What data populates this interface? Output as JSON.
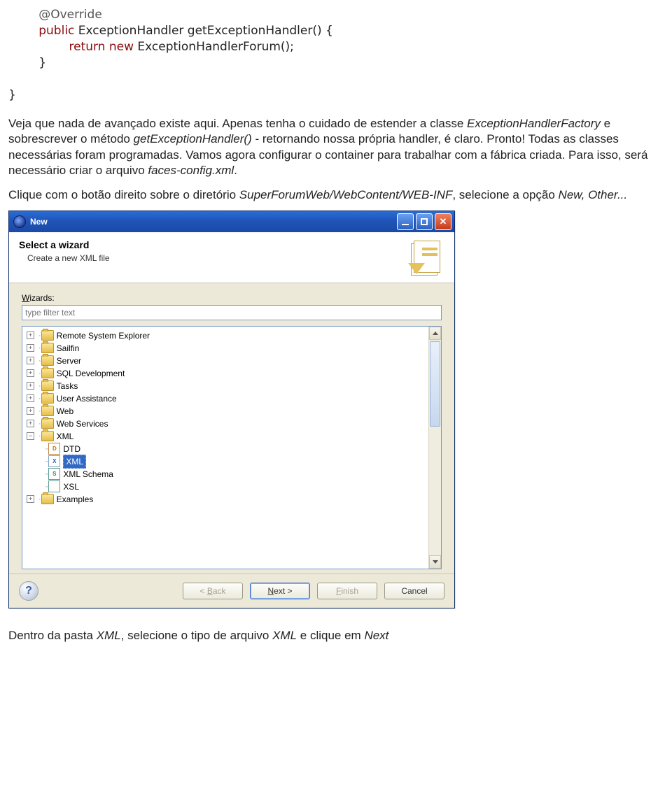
{
  "code": {
    "l1": "@Override",
    "l2a": "public",
    "l2b": " ExceptionHandler getExceptionHandler() {",
    "l3a": "return new",
    "l3b": " ExceptionHandlerForum();",
    "l4": "}",
    "l5": "}"
  },
  "para1_a": "Veja que nada de avançado existe aqui. Apenas tenha o cuidado de estender a classe ",
  "para1_b": "ExceptionHandlerFactory",
  "para1_c": " e sobrescrever o método ",
  "para1_d": "getExceptionHandler()",
  "para1_e": " - retornando nossa própria handler, é claro. Pronto! Todas as classes necessárias foram programadas. Vamos agora configurar o container para trabalhar com a fábrica criada. Para isso, será necessário criar o arquivo ",
  "para1_f": "faces-config.xml",
  "para1_g": ".",
  "para2_a": "Clique com o botão direito sobre o diretório ",
  "para2_b": "SuperForumWeb/WebContent/WEB-INF",
  "para2_c": ", selecione a opção ",
  "para2_d": "New, Other...",
  "dialog": {
    "title": "New",
    "heading": "Select a wizard",
    "subheading": "Create a new XML file",
    "wizards_label_pre": "W",
    "wizards_label_post": "izards:",
    "filter_placeholder": "type filter text",
    "tree": {
      "items": [
        {
          "label": "Remote System Explorer",
          "type": "folder",
          "exp": "+",
          "depth": 0
        },
        {
          "label": "Sailfin",
          "type": "folder",
          "exp": "+",
          "depth": 0
        },
        {
          "label": "Server",
          "type": "folder",
          "exp": "+",
          "depth": 0
        },
        {
          "label": "SQL Development",
          "type": "folder",
          "exp": "+",
          "depth": 0
        },
        {
          "label": "Tasks",
          "type": "folder",
          "exp": "+",
          "depth": 0
        },
        {
          "label": "User Assistance",
          "type": "folder",
          "exp": "+",
          "depth": 0
        },
        {
          "label": "Web",
          "type": "folder",
          "exp": "+",
          "depth": 0
        },
        {
          "label": "Web Services",
          "type": "folder",
          "exp": "+",
          "depth": 0
        },
        {
          "label": "XML",
          "type": "folder",
          "exp": "−",
          "depth": 0
        },
        {
          "label": "DTD",
          "type": "file",
          "icon": "D",
          "cls": "orange",
          "depth": 1
        },
        {
          "label": "XML",
          "type": "file",
          "icon": "X",
          "cls": "",
          "depth": 1,
          "selected": true
        },
        {
          "label": "XML Schema",
          "type": "file",
          "icon": "S",
          "cls": "teal",
          "depth": 1
        },
        {
          "label": "XSL",
          "type": "file",
          "icon": "",
          "cls": "teal",
          "depth": 1
        },
        {
          "label": "Examples",
          "type": "folder",
          "exp": "+",
          "depth": 0
        }
      ]
    },
    "buttons": {
      "back_pre": "< ",
      "back_u": "B",
      "back_post": "ack",
      "next_u": "N",
      "next_post": "ext >",
      "finish_u": "F",
      "finish_post": "inish",
      "cancel": "Cancel"
    },
    "help_glyph": "?"
  },
  "para3_a": "Dentro da pasta ",
  "para3_b": "XML",
  "para3_c": ", selecione o tipo de arquivo ",
  "para3_d": "XML",
  "para3_e": " e clique em ",
  "para3_f": "Next"
}
